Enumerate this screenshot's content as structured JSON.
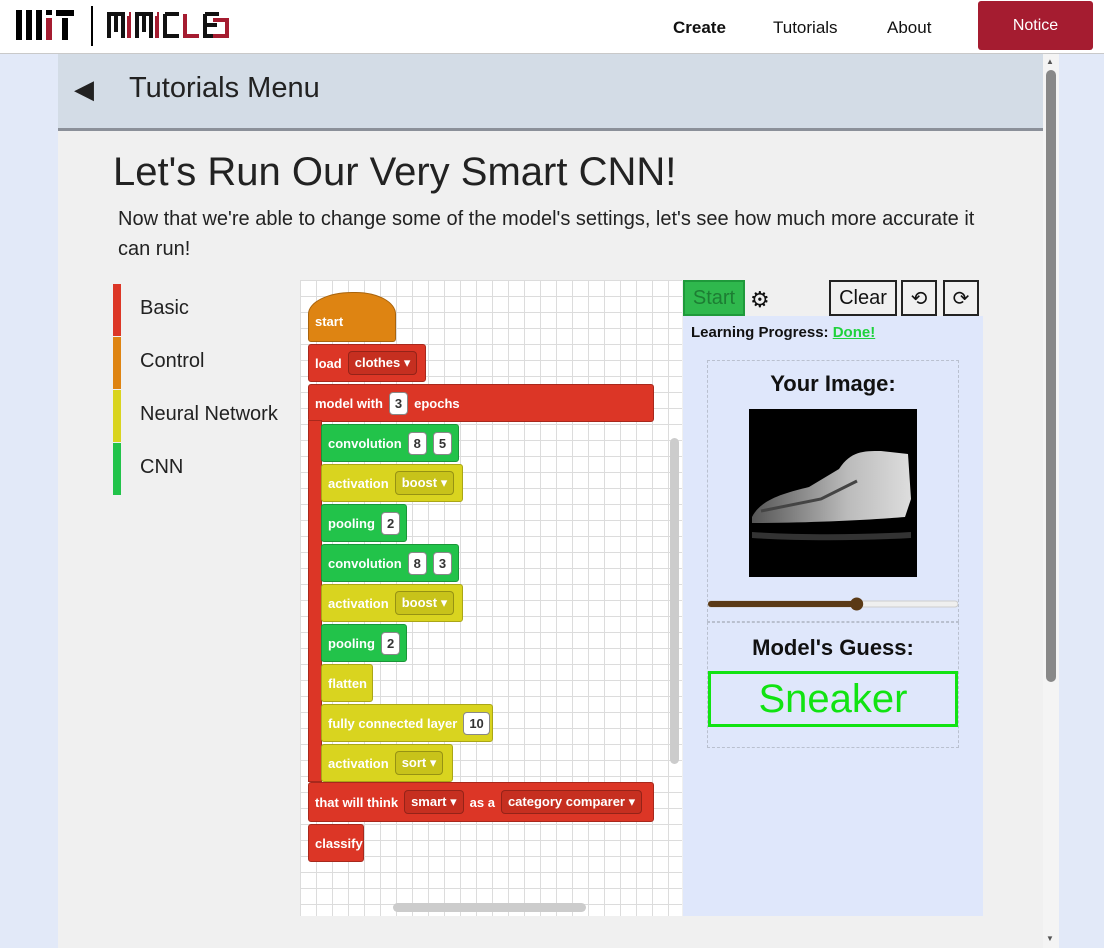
{
  "header": {
    "nav": {
      "create": "Create",
      "tutorials": "Tutorials",
      "about": "About"
    },
    "notice_label": "Notice",
    "brand_color": "#a51c30"
  },
  "tutorial": {
    "menu_title": "Tutorials Menu",
    "page_title": "Let's Run Our Very Smart CNN!",
    "description": "Now that we're able to change some of the model's settings, let's see how much more accurate it can run!"
  },
  "categories": [
    {
      "label": "Basic",
      "color": "#dc3626"
    },
    {
      "label": "Control",
      "color": "#de8412"
    },
    {
      "label": "Neural Network",
      "color": "#d9d41f"
    },
    {
      "label": "CNN",
      "color": "#22c34a"
    }
  ],
  "blocks": {
    "start": "start",
    "load": {
      "label": "load",
      "dataset": "clothes"
    },
    "model": {
      "label_before": "model with",
      "epochs": "3",
      "label_after": "epochs"
    },
    "conv1": {
      "label": "convolution",
      "a": "8",
      "b": "5"
    },
    "act1": {
      "label": "activation",
      "value": "boost"
    },
    "pool1": {
      "label": "pooling",
      "value": "2"
    },
    "conv2": {
      "label": "convolution",
      "a": "8",
      "b": "3"
    },
    "act2": {
      "label": "activation",
      "value": "boost"
    },
    "pool2": {
      "label": "pooling",
      "value": "2"
    },
    "flatten": "flatten",
    "fc": {
      "label": "fully connected layer",
      "value": "10"
    },
    "act3": {
      "label": "activation",
      "value": "sort"
    },
    "think": {
      "label": "that will think",
      "mode": "smart",
      "as_a": "as a",
      "type": "category comparer"
    },
    "classify": "classify"
  },
  "controls": {
    "start_label": "Start",
    "clear_label": "Clear",
    "undo_symbol": "⟲",
    "redo_symbol": "⟳"
  },
  "results": {
    "progress_label": "Learning Progress:",
    "progress_value": "Done!",
    "image_title": "Your Image:",
    "slider_value": 0.6,
    "guess_title": "Model's Guess:",
    "guess_value": "Sneaker"
  }
}
